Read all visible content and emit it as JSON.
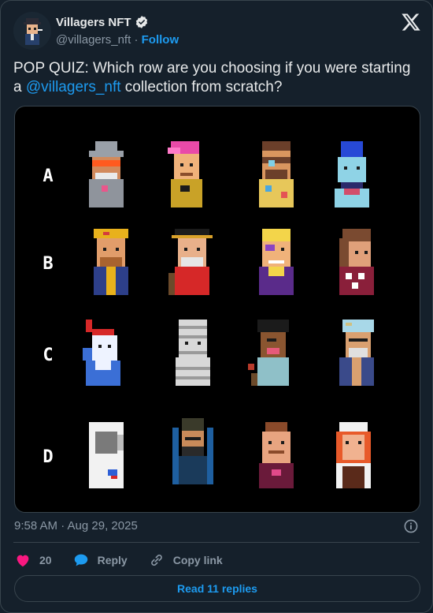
{
  "author": {
    "name": "Villagers NFT",
    "handle": "@villagers_nft",
    "separator": "·",
    "follow_label": "Follow"
  },
  "tweet": {
    "text_before": "POP QUIZ: Which row are you choosing if you were starting a ",
    "mention": "@villagers_nft",
    "text_after": " collection from scratch?"
  },
  "quiz": {
    "rows": [
      {
        "label": "A"
      },
      {
        "label": "B"
      },
      {
        "label": "C"
      },
      {
        "label": "D"
      }
    ]
  },
  "meta": {
    "timestamp": "9:58 AM · Aug 29, 2025"
  },
  "actions": {
    "like_count": "20",
    "reply_label": "Reply",
    "copy_link_label": "Copy link"
  },
  "read_replies_label": "Read 11 replies",
  "colors": {
    "background": "#15202b",
    "accent": "#1d9bf0",
    "like": "#f91880",
    "border": "#38444d"
  }
}
